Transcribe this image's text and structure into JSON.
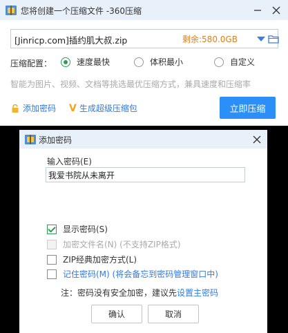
{
  "main_window": {
    "title": "您将创建一个压缩文件 -360压缩",
    "path": "[Jinricp.com]插约肌大叔.zip",
    "remaining": "剩余:580.0GB",
    "compress_config_label": "压缩配置：",
    "options": [
      {
        "label": "速度最快",
        "selected": true
      },
      {
        "label": "体积最小",
        "selected": false
      },
      {
        "label": "自定义",
        "selected": false
      }
    ],
    "hint": "智能为图片、视频、文档等挑选最优压缩方式，兼具速度和压缩率",
    "add_password_link": "添加密码",
    "super_package_link": "生成超级压缩包",
    "compress_button": "立即压缩"
  },
  "password_dialog": {
    "title": "添加密码",
    "field_label": "输入密码(E)",
    "password_value": "我爱书院从未离开",
    "checkboxes": [
      {
        "label": "显示密码(S)",
        "checked": true,
        "disabled": false
      },
      {
        "label": "加密文件名(N) (不支持ZIP格式)",
        "checked": false,
        "disabled": true
      },
      {
        "label": "ZIP经典加密方式(L)",
        "checked": false,
        "disabled": false
      },
      {
        "label": "记住密码(M) (将会备忘到密码管理窗口中)",
        "checked": false,
        "disabled": false
      }
    ],
    "note_prefix": "注：密码没有安全加密，建议先",
    "note_link": "设置主密码",
    "ok_button": "确认",
    "cancel_button": "取消"
  },
  "colors": {
    "accent_blue": "#2b8ff7",
    "link_blue": "#2f7ae5",
    "green": "#2aa152",
    "orange": "#e87c11",
    "titlebar": "#e8f0fa"
  },
  "icons": [
    "app-logo-icon",
    "minimize-icon",
    "close-icon",
    "dropdown-arrow-icon",
    "folder-icon",
    "lock-icon",
    "v-badge-icon"
  ]
}
